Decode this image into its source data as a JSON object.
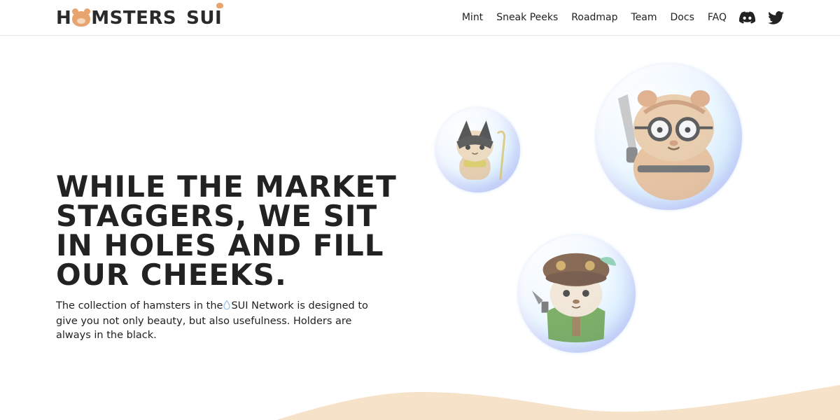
{
  "header": {
    "logo": {
      "text_h": "H",
      "text_rest": "MSTERS",
      "text_sui": "SUI"
    },
    "nav": [
      {
        "label": "Mint"
      },
      {
        "label": "Sneak Peeks"
      },
      {
        "label": "Roadmap"
      },
      {
        "label": "Team"
      },
      {
        "label": "Docs"
      },
      {
        "label": "FAQ"
      }
    ],
    "icons": [
      "discord-icon",
      "twitter-icon"
    ]
  },
  "hero": {
    "headline_lines": [
      "WHILE THE MARKET",
      "STAGGERS, WE SIT",
      "IN HOLES AND FILL",
      "OUR CHEEKS."
    ],
    "description_before": "The collection of hamsters in the",
    "description_network": "SUI Network",
    "description_after": "is designed to give you not only beauty, but also usefulness. Holders are always in the black."
  },
  "colors": {
    "text": "#1d1d1d",
    "logo_accent": "#e8a46e",
    "wave": "#f5e2c8",
    "sui_drop": "#9fc8ee"
  }
}
